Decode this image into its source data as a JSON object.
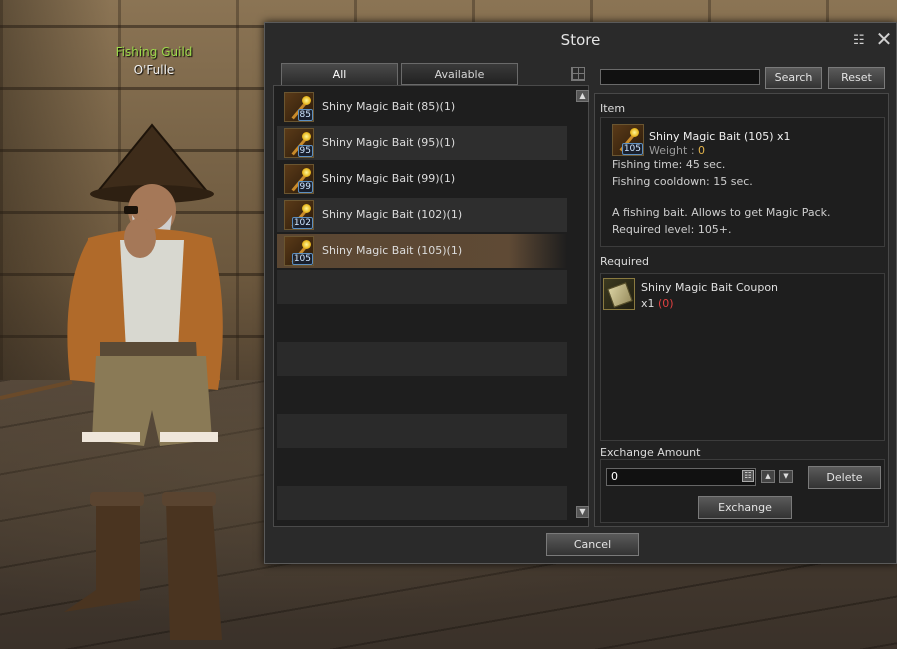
{
  "npc": {
    "guild": "Fishing Guild",
    "name": "O'Fulle"
  },
  "store": {
    "title": "Store",
    "tabs": [
      {
        "label": "All",
        "active": true
      },
      {
        "label": "Available",
        "active": false
      }
    ],
    "items": [
      {
        "label": "Shiny Magic Bait (85)(1)",
        "badge": "85"
      },
      {
        "label": "Shiny Magic Bait (95)(1)",
        "badge": "95"
      },
      {
        "label": "Shiny Magic Bait (99)(1)",
        "badge": "99"
      },
      {
        "label": "Shiny Magic Bait (102)(1)",
        "badge": "102"
      },
      {
        "label": "Shiny Magic Bait (105)(1)",
        "badge": "105",
        "selected": true
      }
    ],
    "search": {
      "value": "",
      "button": "Search",
      "reset": "Reset"
    },
    "detail": {
      "section_label": "Item",
      "name": "Shiny Magic Bait (105) x1",
      "badge": "105",
      "weight_label": "Weight : ",
      "weight_value": "0",
      "lines": [
        "Fishing time: 45 sec.",
        "Fishing cooldown: 15 sec.",
        "",
        "A fishing bait. Allows to get Magic Pack.",
        "Required level: 105+."
      ]
    },
    "required": {
      "section_label": "Required",
      "name": "Shiny Magic Bait Coupon",
      "qty_prefix": "x1 ",
      "have": "(0)"
    },
    "exchange": {
      "section_label": "Exchange Amount",
      "amount": "0",
      "delete_label": "Delete",
      "exchange_label": "Exchange"
    },
    "cancel_label": "Cancel"
  },
  "colors": {
    "guild_name": "#9cd94a",
    "weight_value": "#e2b24a",
    "have_count": "#e04040",
    "selected_row": "#5f4a35"
  }
}
